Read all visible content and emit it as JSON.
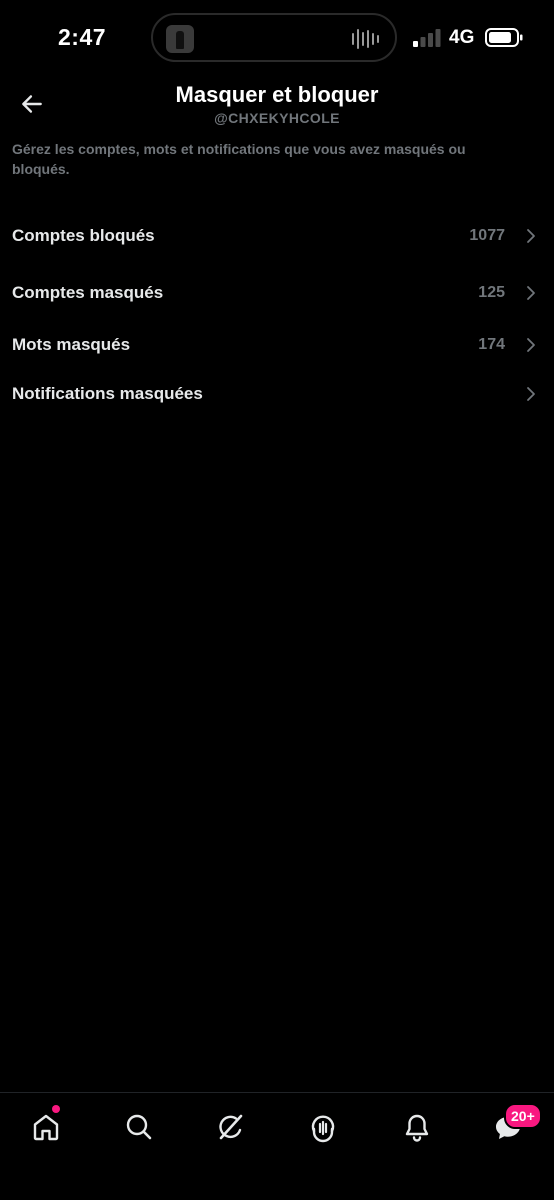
{
  "status_bar": {
    "time": "2:47",
    "network": "4G",
    "signal_icon": "cellular-signal-icon",
    "battery_icon": "battery-icon"
  },
  "header": {
    "back_icon": "back-arrow-icon",
    "title": "Masquer et bloquer",
    "subtitle": "@CHXEKYHCOLE"
  },
  "description": "Gérez les comptes, mots et notifications que vous avez masqués ou bloqués.",
  "menu": {
    "items": [
      {
        "label": "Comptes bloqués",
        "count": "1077"
      },
      {
        "label": "Comptes masqués",
        "count": "125"
      },
      {
        "label": "Mots masqués",
        "count": "174"
      },
      {
        "label": "Notifications masquées",
        "count": ""
      }
    ]
  },
  "bottom_nav": {
    "items": [
      "home-icon",
      "search-icon",
      "grok-icon",
      "spaces-icon",
      "notifications-bell-icon",
      "messages-icon"
    ],
    "messages_badge": "20+"
  },
  "colors": {
    "background": "#000000",
    "primary_text": "#e7e9ea",
    "secondary_text": "#71767b",
    "accent_badge": "#f91880"
  }
}
